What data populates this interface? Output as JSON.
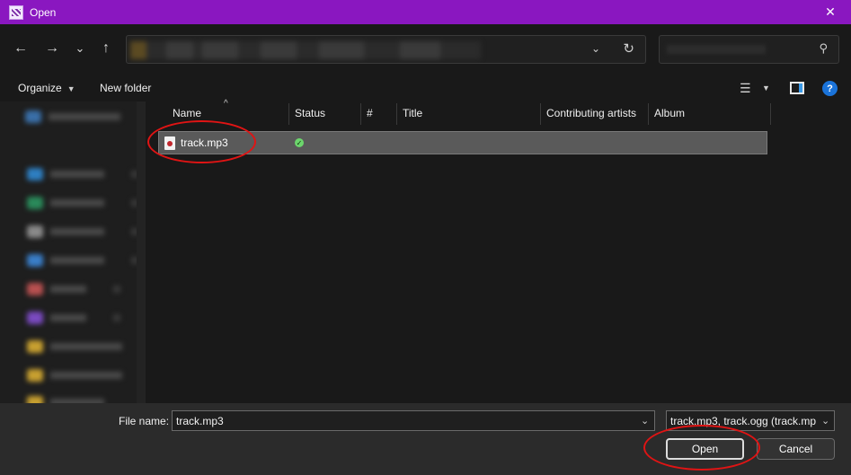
{
  "window": {
    "title": "Open",
    "close_glyph": "✕"
  },
  "nav": {
    "back_glyph": "←",
    "forward_glyph": "→",
    "recent_glyph": "⌄",
    "up_glyph": "↑",
    "address_dropdown_glyph": "⌄",
    "refresh_glyph": "↻",
    "search_glyph": "⚲"
  },
  "toolbar": {
    "organize_label": "Organize",
    "organize_caret": "▼",
    "new_folder_label": "New folder",
    "view_glyph": "☰",
    "view_caret": "▼",
    "help_glyph": "?"
  },
  "columns": [
    {
      "label": "Name"
    },
    {
      "label": "Status"
    },
    {
      "label": "#"
    },
    {
      "label": "Title"
    },
    {
      "label": "Contributing artists"
    },
    {
      "label": "Album"
    }
  ],
  "sort_indicator": "^",
  "files": [
    {
      "name": "track.mp3",
      "status_icon": "synced-check-icon"
    }
  ],
  "status_glyph": "✓",
  "footer": {
    "file_name_label": "File name:",
    "file_name_value": "track.mp3",
    "file_name_chevron": "⌄",
    "file_type_value": "track.mp3, track.ogg (track.mp",
    "file_type_chevron": "⌄",
    "open_label": "Open",
    "cancel_label": "Cancel"
  },
  "colors": {
    "titlebar": "#8a17c0",
    "annotation": "#e01414",
    "help_blue": "#1a73d9",
    "status_green": "#6cd66c"
  }
}
